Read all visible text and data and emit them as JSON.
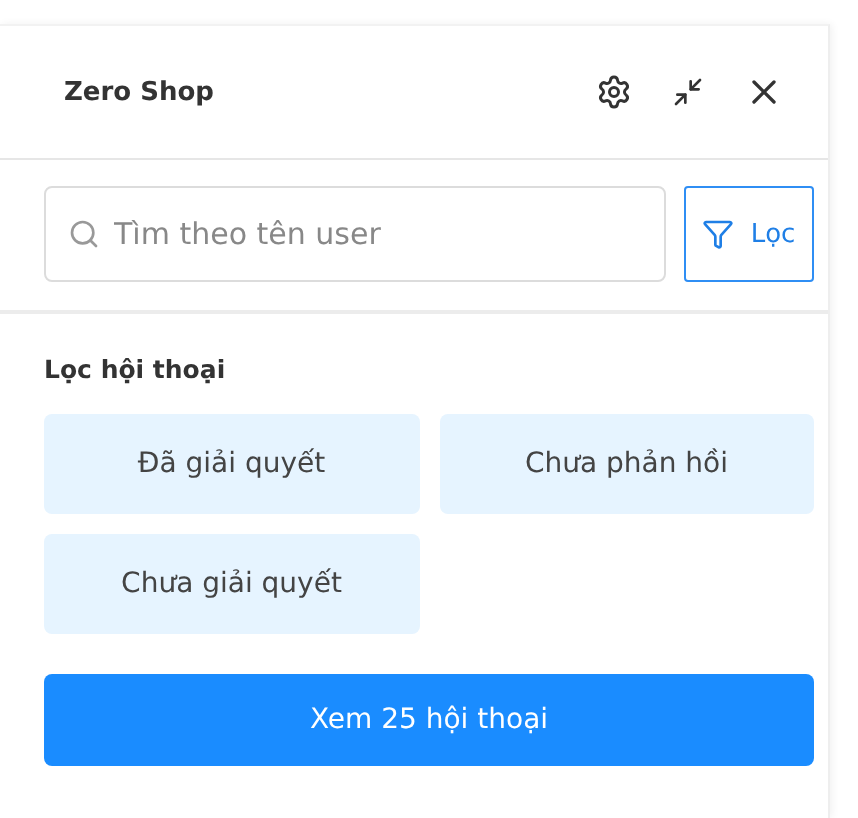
{
  "header": {
    "title": "Zero Shop"
  },
  "search": {
    "placeholder": "Tìm theo tên user"
  },
  "filter_button": {
    "label": "Lọc"
  },
  "filter_panel": {
    "heading": "Lọc hội thoại",
    "options": [
      {
        "label": "Đã giải quyết",
        "selected": false
      },
      {
        "label": "Chưa phản hồi",
        "selected": false
      },
      {
        "label": "Chưa giải quyết",
        "selected": false
      }
    ],
    "submit": "Xem 25 hội thoại"
  }
}
